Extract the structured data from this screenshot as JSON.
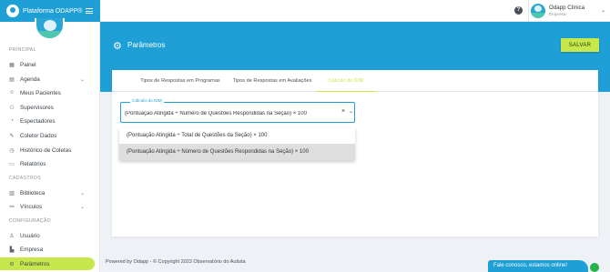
{
  "app": {
    "name": "Plataforma ODAPP®"
  },
  "user": {
    "name": "Odapp Clínica",
    "role": "Empresa"
  },
  "sidebar": {
    "sections": [
      {
        "title": "PRINCIPAL"
      },
      {
        "title": "CADASTROS"
      },
      {
        "title": "CONFIGURAÇÃO"
      }
    ],
    "items": [
      {
        "label": "Painel",
        "icon": "dashboard-icon"
      },
      {
        "label": "Agenda",
        "icon": "calendar-icon"
      },
      {
        "label": "Meus Pacientes",
        "icon": "patients-icon"
      },
      {
        "label": "Supervisores",
        "icon": "supervisors-icon"
      },
      {
        "label": "Espectadores",
        "icon": "spectators-icon"
      },
      {
        "label": "Coletor Dados",
        "icon": "pencil-icon"
      },
      {
        "label": "Histórico de Coletas",
        "icon": "history-icon"
      },
      {
        "label": "Relatórios",
        "icon": "reports-icon"
      },
      {
        "label": "Biblioteca",
        "icon": "library-icon"
      },
      {
        "label": "Vínculos",
        "icon": "link-icon"
      },
      {
        "label": "Usuário",
        "icon": "user-icon"
      },
      {
        "label": "Empresa",
        "icon": "company-icon"
      },
      {
        "label": "Parâmetros",
        "icon": "gear-icon"
      }
    ]
  },
  "page": {
    "title": "Parâmetros",
    "save_label": "SALVAR"
  },
  "tabs": [
    {
      "label": "Tipos de Respostas em Programas"
    },
    {
      "label": "Tipos de Respostas em Avaliações"
    },
    {
      "label": "Cálculo do IDM"
    }
  ],
  "idm": {
    "label": "Cálculo do IDM",
    "value": "(Pontuação Atingida ÷ Número de Questões Respondidas na Seção) × 100",
    "clear": "×",
    "options": [
      "(Pontuação Atingida ÷ Total de Questões da Seção) × 100",
      "(Pontuação Atingida ÷ Número de Questões Respondidas na Seção) × 100"
    ]
  },
  "footer": {
    "text": "Powered by Odapp - © Copyright 2023 Observatório do Autista"
  },
  "chat": {
    "label": "Fale conosco, estamos online!"
  },
  "colors": {
    "primary": "#1e9fd6",
    "accent": "#c6e84a",
    "online": "#25b24a"
  }
}
